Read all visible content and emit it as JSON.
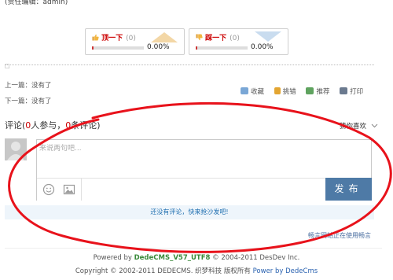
{
  "page": {
    "top_cut_text": "(责任编辑：admin)"
  },
  "votes": {
    "up": {
      "label": "顶一下",
      "count": "(0)",
      "percent": "0.00%",
      "progress": 0
    },
    "down": {
      "label": "踩一下",
      "count": "(0)",
      "percent": "0.00%",
      "progress": 0
    }
  },
  "nav": {
    "prev": "上一篇：没有了",
    "next": "下一篇：没有了"
  },
  "actions": {
    "favorite": "收藏",
    "report": "挑错",
    "recommend": "推荐",
    "print": "打印"
  },
  "comments": {
    "title_prefix": "评论(",
    "participants": "0",
    "mid": "人参与，",
    "count": "0",
    "suffix": "条评论)",
    "guess": "猜你喜欢",
    "placeholder": "来说两句吧...",
    "publish_label": "发布",
    "empty": "还没有评论，快来抢沙发吧!",
    "online": "畅言网站正在使用畅言"
  },
  "footer": {
    "powered_prefix": "Powered by ",
    "powered_brand": "DedeCMS_V57_UTF8",
    "powered_suffix": " © 2004-2011 DesDev Inc.",
    "copyright": "Copyright © 2002-2011 DEDECMS. 织梦科技 版权所有 ",
    "copyright_link": "Power by DedeCms"
  },
  "colors": {
    "accent_red": "#c00",
    "publish_bg": "#4e7aa6",
    "banner_bg": "#eef5fb",
    "annotation": "#e8121b"
  }
}
